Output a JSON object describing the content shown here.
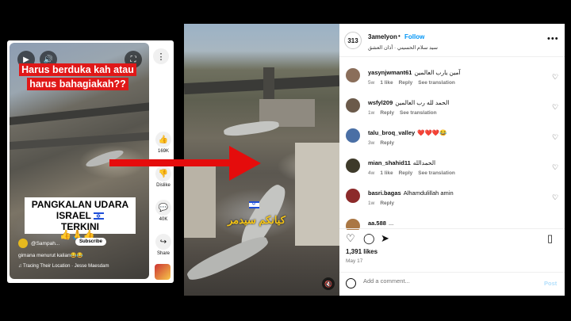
{
  "short": {
    "caption_top": "Harus berduka kah atau harus bahagiakah??",
    "caption_bottom_line1": "PANGKALAN UDARA",
    "caption_bottom_line2": "ISRAEL",
    "caption_bottom_line3": "TERKINI",
    "emojis": "👍🙏👍",
    "channel_name": "@Sampah...",
    "subscribe_label": "Subscribe",
    "description": "gimana menurut kalian😂😂",
    "music": "♫ Tracing Their Location · Jesse Maesdam",
    "actions": [
      {
        "icon": "thumbs-up-icon",
        "glyph": "👍",
        "label": "169K"
      },
      {
        "icon": "thumbs-down-icon",
        "glyph": "👎",
        "label": "Dislike"
      },
      {
        "icon": "comment-icon",
        "glyph": "💬",
        "label": "40K"
      },
      {
        "icon": "share-icon",
        "glyph": "↪",
        "label": "Share"
      }
    ]
  },
  "video": {
    "overlay_text": "كيانكم سيدمر"
  },
  "instagram": {
    "avatar_text": "313",
    "username": "3amelyon",
    "separator": "•",
    "follow_label": "Follow",
    "subtitle": "سيد سلام الحسيني · أذان العشق",
    "more_label": "•••",
    "comments": [
      {
        "user": "yasynjwmant61",
        "text": "آمين يارب العالمين",
        "time": "5w",
        "likes": "1 like",
        "reply": "Reply",
        "translate": "See translation",
        "avatar_color": "#8a6e5a"
      },
      {
        "user": "wsfyl209",
        "text": "الحمد لله رب العالمين",
        "time": "1w",
        "likes": "",
        "reply": "Reply",
        "translate": "See translation",
        "avatar_color": "#6b5a4a"
      },
      {
        "user": "talu_broq_valley",
        "text": "❤️❤️❤️😂",
        "time": "3w",
        "likes": "",
        "reply": "Reply",
        "translate": "",
        "avatar_color": "#4a6fa5"
      },
      {
        "user": "mian_shahid11",
        "text": "الحمدالله",
        "time": "4w",
        "likes": "1 like",
        "reply": "Reply",
        "translate": "See translation",
        "avatar_color": "#3e3a2a"
      },
      {
        "user": "basri.bagas",
        "text": "Alhamdulillah amin",
        "time": "1w",
        "likes": "",
        "reply": "Reply",
        "translate": "",
        "avatar_color": "#8c2a2a"
      },
      {
        "user": "aa.588",
        "text": "...",
        "time": "",
        "likes": "",
        "reply": "",
        "translate": "",
        "avatar_color": "#aa7744"
      }
    ],
    "likes": "1,391 likes",
    "date": "May 17",
    "comment_placeholder": "Add a comment...",
    "post_label": "Post"
  },
  "colors": {
    "arrow": "#e50c0c",
    "caption_red": "#e01818",
    "follow_blue": "#0095f6"
  }
}
